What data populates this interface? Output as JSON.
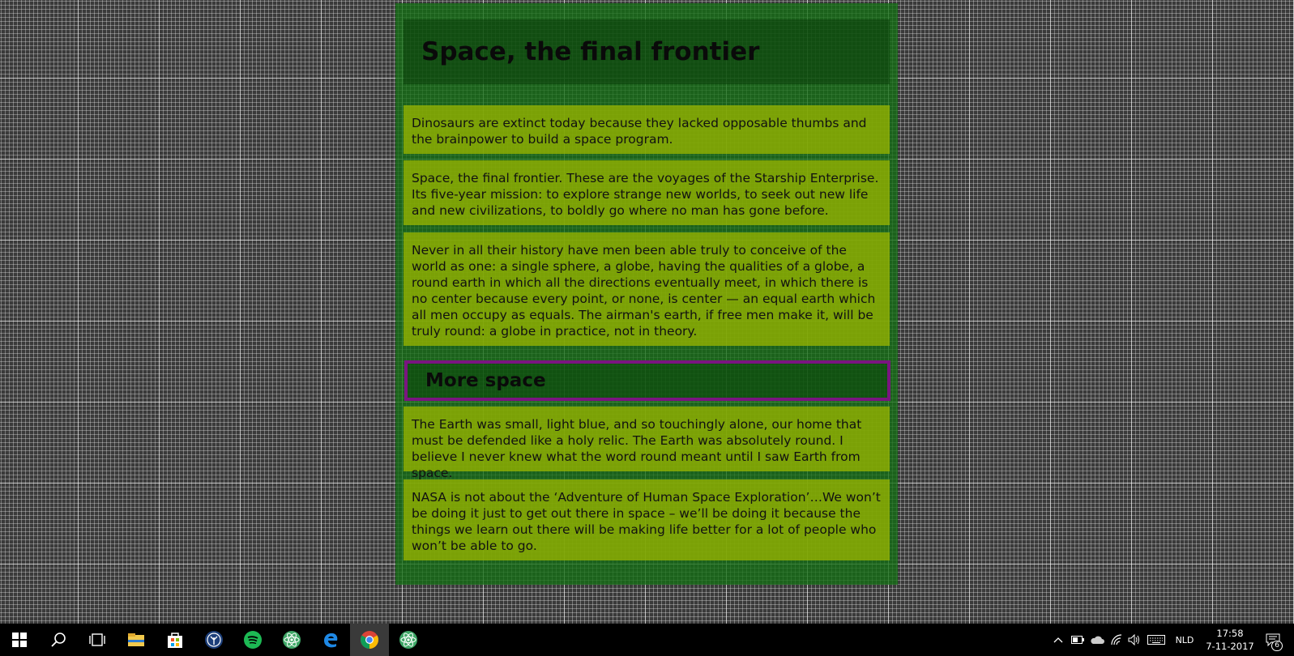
{
  "page": {
    "title": "Space, the final frontier",
    "subheading": "More space",
    "paragraphs_top": [
      "Dinosaurs are extinct today because they lacked opposable thumbs and the brainpower to build a space program.",
      "Space, the final frontier. These are the voyages of the Starship Enterprise. Its five-year mission: to explore strange new worlds, to seek out new life and new civilizations, to boldly go where no man has gone before.",
      "Never in all their history have men been able truly to conceive of the world as one: a single sphere, a globe, having the qualities of a globe, a round earth in which all the directions eventually meet, in which there is no center because every point, or none, is center — an equal earth which all men occupy as equals. The airman's earth, if free men make it, will be truly round: a globe in practice, not in theory."
    ],
    "paragraphs_bottom": [
      "The Earth was small, light blue, and so touchingly alone, our home that must be defended like a holy relic. The Earth was absolutely round. I believe I never knew what the word round meant until I saw Earth from space.",
      "NASA is not about the ‘Adventure of Human Space Exploration’…We won’t be doing it just to get out there in space – we’ll be doing it because the things we learn out there will be making life better for a lot of people who won’t be able to go."
    ]
  },
  "taskbar": {
    "apps": [
      {
        "name": "start",
        "icon": "windows-logo-icon"
      },
      {
        "name": "search",
        "icon": "search-icon"
      },
      {
        "name": "task-view",
        "icon": "task-view-icon"
      },
      {
        "name": "file-explorer",
        "icon": "folder-icon"
      },
      {
        "name": "store",
        "icon": "store-bag-icon"
      },
      {
        "name": "app-blue",
        "icon": "tree-app-icon"
      },
      {
        "name": "spotify",
        "icon": "spotify-icon"
      },
      {
        "name": "atom",
        "icon": "atom-icon"
      },
      {
        "name": "edge",
        "icon": "edge-icon"
      },
      {
        "name": "chrome",
        "icon": "chrome-icon"
      },
      {
        "name": "atom-2",
        "icon": "atom-icon"
      }
    ],
    "language": "NLD",
    "time": "17:58",
    "date": "7-11-2017",
    "notification_count": "6"
  },
  "colors": {
    "page_bg": "#1e7a1e",
    "card_bg": "#9ab400",
    "subhead_border": "#7a1580",
    "taskbar_bg": "#000000"
  }
}
